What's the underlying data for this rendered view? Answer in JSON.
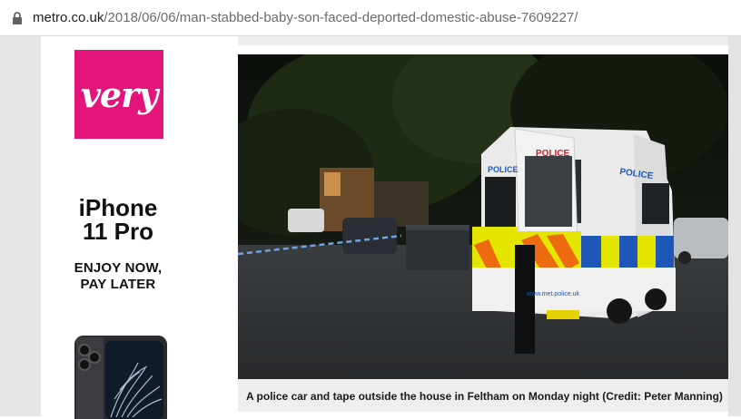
{
  "browser": {
    "url_domain": "metro.co.uk",
    "url_path": "/2018/06/06/man-stabbed-baby-son-faced-deported-domestic-abuse-7609227/",
    "lock_icon": "lock-icon"
  },
  "ad": {
    "brand": "very",
    "brand_color": "#e3157c",
    "headline_line1": "iPhone",
    "headline_line2": "11 Pro",
    "sub_line1": "ENJOY NOW,",
    "sub_line2": "PAY LATER"
  },
  "article": {
    "image_van_label": "POLICE",
    "image_van_side": "POLICE",
    "image_van_url": "www.met.police.uk",
    "image_caption": "A police car and tape outside the house in Feltham on Monday night (Credit: Peter Manning)"
  }
}
